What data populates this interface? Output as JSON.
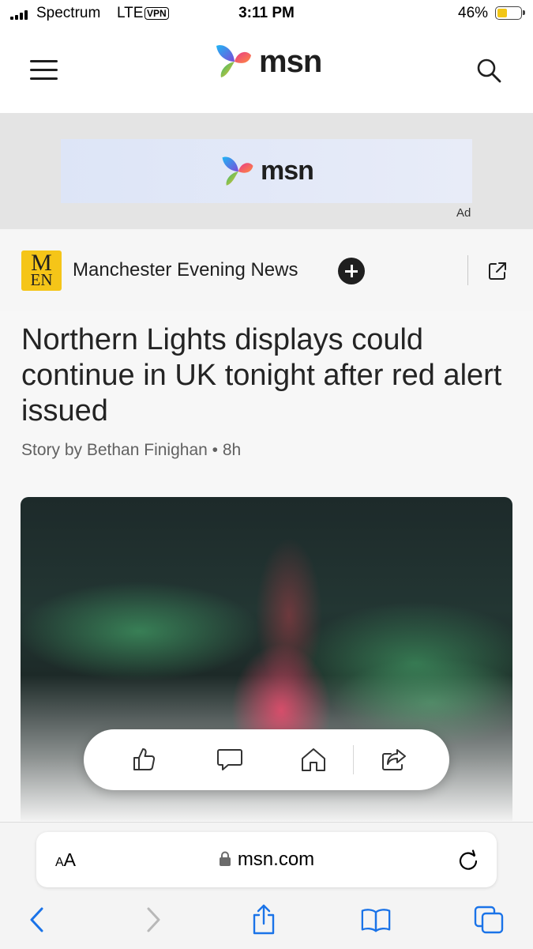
{
  "status_bar": {
    "carrier": "Spectrum",
    "network": "LTE",
    "vpn": "VPN",
    "time": "3:11 PM",
    "battery_percent": "46%",
    "battery_level": 0.46,
    "battery_color": "#f2c617"
  },
  "header": {
    "menu_icon": "hamburger-menu-icon",
    "logo_text": "msn",
    "search_icon": "search-icon"
  },
  "ad": {
    "logo_text": "msn",
    "label": "Ad"
  },
  "publisher": {
    "logo_top": "M",
    "logo_bottom": "EN",
    "logo_color": "#f5c518",
    "name": "Manchester Evening News",
    "follow_icon": "plus-circle-icon",
    "external_icon": "external-link-icon"
  },
  "article": {
    "headline": "Northern Lights displays could continue in UK tonight after red alert issued",
    "byline": "Story by Bethan Finighan • 8h"
  },
  "action_bar": {
    "items": [
      {
        "icon": "thumbs-up-icon"
      },
      {
        "icon": "comment-icon"
      },
      {
        "icon": "home-icon"
      },
      {
        "icon": "share-icon"
      }
    ]
  },
  "browser": {
    "text_size_label_small": "A",
    "text_size_label_large": "A",
    "url": "msn.com",
    "lock_icon": "lock-icon",
    "reload_icon": "reload-icon",
    "nav": [
      "back-icon",
      "forward-icon",
      "share-icon",
      "bookmarks-icon",
      "tabs-icon"
    ]
  },
  "colors": {
    "accent_blue": "#1a73e8",
    "text_primary": "#242424",
    "text_secondary": "#616161"
  }
}
